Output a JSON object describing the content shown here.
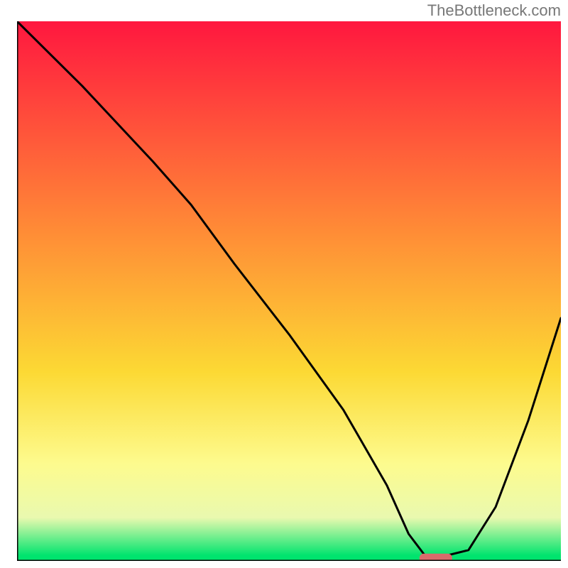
{
  "watermark": "TheBottleneck.com",
  "chart_data": {
    "type": "line",
    "title": "",
    "xlabel": "",
    "ylabel": "",
    "xlim": [
      0,
      100
    ],
    "ylim": [
      0,
      100
    ],
    "axes_visible": {
      "left": true,
      "bottom": true,
      "right": false,
      "top": false
    },
    "background_gradient": {
      "stops": [
        {
          "offset": 0.0,
          "color": "#ff173f"
        },
        {
          "offset": 0.4,
          "color": "#ff8f36"
        },
        {
          "offset": 0.65,
          "color": "#fcd934"
        },
        {
          "offset": 0.82,
          "color": "#fdfb8e"
        },
        {
          "offset": 0.92,
          "color": "#e9f9af"
        },
        {
          "offset": 0.99,
          "color": "#00e46e"
        },
        {
          "offset": 1.0,
          "color": "#00e46e"
        }
      ]
    },
    "curve": {
      "x": [
        0,
        12,
        25,
        32,
        40,
        50,
        60,
        68,
        72,
        75,
        79,
        83,
        88,
        94,
        100
      ],
      "y_pct": [
        100,
        88,
        74,
        66,
        55,
        42,
        28,
        14,
        5,
        1,
        1,
        2,
        10,
        26,
        45
      ]
    },
    "marker": {
      "x_pct": 77,
      "y_pct": 0.5,
      "width_pct": 6,
      "height_pct": 1.7,
      "color": "#d86b6b",
      "rx": 6
    },
    "axis_color": "#000000",
    "axis_width": 3,
    "curve_color": "#000000",
    "curve_width": 3
  }
}
